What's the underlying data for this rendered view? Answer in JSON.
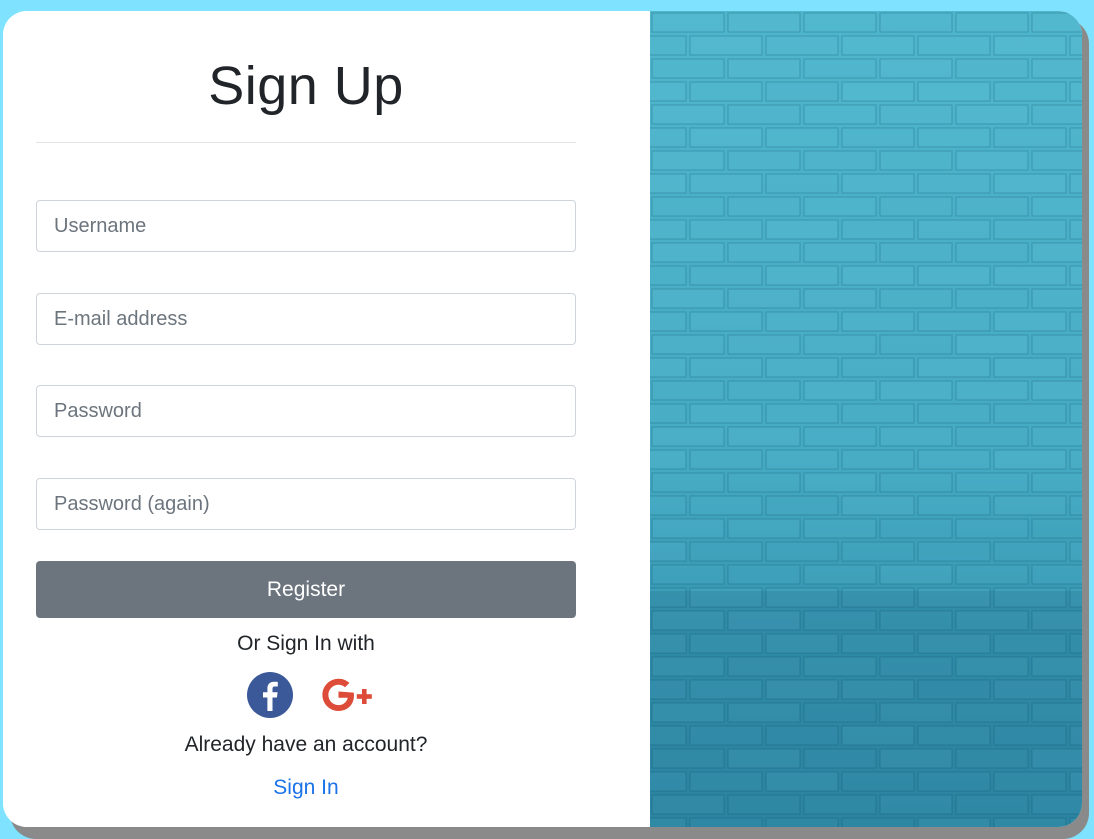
{
  "form": {
    "title": "Sign Up",
    "fields": [
      {
        "placeholder": "Username",
        "value": ""
      },
      {
        "placeholder": "E-mail address",
        "value": ""
      },
      {
        "placeholder": "Password",
        "value": ""
      },
      {
        "placeholder": "Password (again)",
        "value": ""
      }
    ],
    "register_label": "Register",
    "or_text": "Or Sign In with",
    "social": [
      {
        "icon": "facebook-icon",
        "color": "#3b5998"
      },
      {
        "icon": "google-plus-icon",
        "color": "#dd4b39"
      }
    ],
    "already_text": "Already have an account?",
    "signin_label": "Sign In"
  },
  "colors": {
    "background": "#7fe3ff",
    "button": "#6c757d",
    "link": "#1a73e8",
    "image_panel": "#45aac3"
  }
}
